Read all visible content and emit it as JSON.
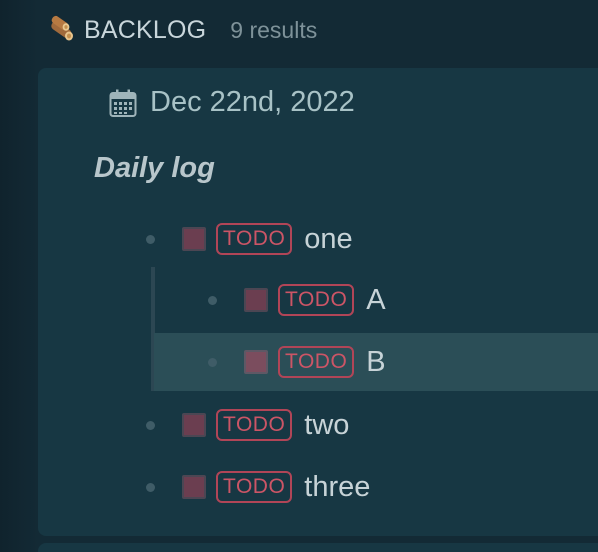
{
  "header": {
    "title": "BACKLOG",
    "count": "9 results"
  },
  "entry": {
    "date": "Dec 22nd, 2022",
    "section_title": "Daily log"
  },
  "items": [
    {
      "badge": "TODO",
      "text": "one"
    },
    {
      "badge": "TODO",
      "text": "A"
    },
    {
      "badge": "TODO",
      "text": "B"
    },
    {
      "badge": "TODO",
      "text": "two"
    },
    {
      "badge": "TODO",
      "text": "three"
    }
  ],
  "colors": {
    "background": "#132a35",
    "card": "#173743",
    "selected_row": "#2b4e57",
    "todo_badge": "#cc5566",
    "checkbox": "#6b3e50"
  }
}
